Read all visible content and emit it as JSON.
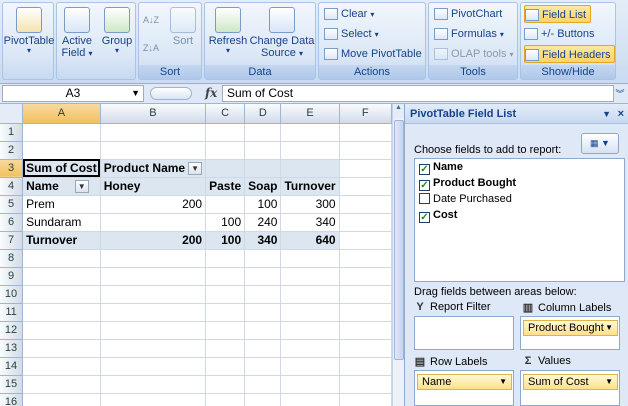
{
  "ribbon": {
    "pivottable": {
      "label": "PivotTable"
    },
    "active_field": {
      "label_line1": "Active",
      "label_line2": "Field"
    },
    "group": {
      "label": "Group"
    },
    "sort": {
      "label": "Sort",
      "group_label": "Sort",
      "az": "A Z",
      "za": "Z A"
    },
    "data": {
      "refresh": "Refresh",
      "change_line1": "Change Data",
      "change_line2": "Source",
      "group_label": "Data"
    },
    "actions": {
      "clear": "Clear",
      "select": "Select",
      "move": "Move PivotTable",
      "group_label": "Actions"
    },
    "tools": {
      "pivotchart": "PivotChart",
      "formulas": "Formulas",
      "olap": "OLAP tools",
      "group_label": "Tools"
    },
    "showhide": {
      "field_list": "Field List",
      "buttons": "+/- Buttons",
      "field_headers": "Field Headers",
      "group_label": "Show/Hide"
    }
  },
  "formula_bar": {
    "name_box": "A3",
    "fx": "fx",
    "formula": "Sum of Cost"
  },
  "grid": {
    "columns": [
      "A",
      "B",
      "C",
      "D",
      "E",
      "F"
    ],
    "rows": [
      {
        "num": "1",
        "cells": [
          "",
          "",
          "",
          "",
          "",
          ""
        ]
      },
      {
        "num": "2",
        "cells": [
          "",
          "",
          "",
          "",
          "",
          ""
        ]
      },
      {
        "num": "3",
        "cells": [
          "Sum of Cost",
          "Product Name",
          "",
          "",
          "",
          ""
        ]
      },
      {
        "num": "4",
        "cells": [
          "Name",
          "Honey",
          "Paste",
          "Soap",
          "Turnover",
          ""
        ]
      },
      {
        "num": "5",
        "cells": [
          "Prem",
          "200",
          "",
          "100",
          "300",
          ""
        ]
      },
      {
        "num": "6",
        "cells": [
          "Sundaram",
          "",
          "100",
          "240",
          "340",
          ""
        ]
      },
      {
        "num": "7",
        "cells": [
          "Turnover",
          "200",
          "100",
          "340",
          "640",
          ""
        ]
      },
      {
        "num": "8",
        "cells": [
          "",
          "",
          "",
          "",
          "",
          ""
        ]
      },
      {
        "num": "9",
        "cells": [
          "",
          "",
          "",
          "",
          "",
          ""
        ]
      },
      {
        "num": "10",
        "cells": [
          "",
          "",
          "",
          "",
          "",
          ""
        ]
      },
      {
        "num": "11",
        "cells": [
          "",
          "",
          "",
          "",
          "",
          ""
        ]
      },
      {
        "num": "12",
        "cells": [
          "",
          "",
          "",
          "",
          "",
          ""
        ]
      },
      {
        "num": "13",
        "cells": [
          "",
          "",
          "",
          "",
          "",
          ""
        ]
      },
      {
        "num": "14",
        "cells": [
          "",
          "",
          "",
          "",
          "",
          ""
        ]
      },
      {
        "num": "15",
        "cells": [
          "",
          "",
          "",
          "",
          "",
          ""
        ]
      },
      {
        "num": "16",
        "cells": [
          "",
          "",
          "",
          "",
          "",
          ""
        ]
      }
    ]
  },
  "field_list": {
    "title": "PivotTable Field List",
    "choose_label": "Choose fields to add to report:",
    "fields": [
      {
        "name": "Name",
        "checked": true
      },
      {
        "name": "Product Bought",
        "checked": true
      },
      {
        "name": "Date Purchased",
        "checked": false
      },
      {
        "name": "Cost",
        "checked": true
      }
    ],
    "drag_label": "Drag fields between areas below:",
    "areas": {
      "report_filter": {
        "label": "Report Filter"
      },
      "column_labels": {
        "label": "Column Labels",
        "item": "Product Bought"
      },
      "row_labels": {
        "label": "Row Labels",
        "item": "Name"
      },
      "values": {
        "label": "Values",
        "item": "Sum of Cost"
      }
    }
  },
  "colors": {
    "accent": "#15428b",
    "pivot_header": "#dce6f1",
    "highlight": "#fbd46a"
  }
}
